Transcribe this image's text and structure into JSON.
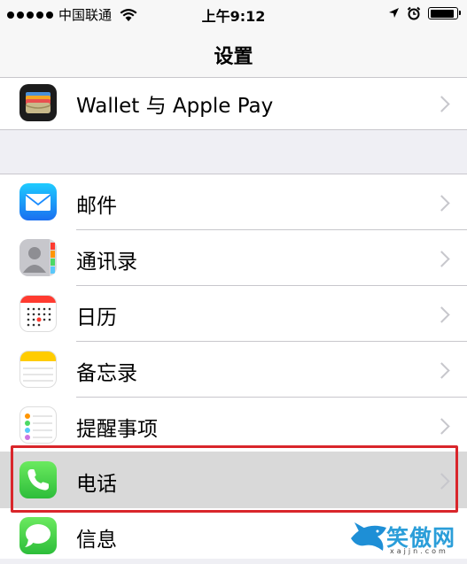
{
  "status_bar": {
    "carrier": "中国联通",
    "time": "上午9:12",
    "battery_level": 0.95
  },
  "nav": {
    "title": "设置"
  },
  "top_group": {
    "items": [
      {
        "label": "Wallet 与 Apple Pay",
        "icon": "wallet-icon"
      }
    ]
  },
  "main_group": {
    "items": [
      {
        "label": "邮件",
        "icon": "mail-icon"
      },
      {
        "label": "通讯录",
        "icon": "contacts-icon"
      },
      {
        "label": "日历",
        "icon": "calendar-icon"
      },
      {
        "label": "备忘录",
        "icon": "notes-icon"
      },
      {
        "label": "提醒事项",
        "icon": "reminders-icon"
      },
      {
        "label": "电话",
        "icon": "phone-icon",
        "highlighted": true
      },
      {
        "label": "信息",
        "icon": "messages-icon"
      }
    ]
  },
  "watermark": {
    "text": "笑傲网",
    "sub": "xajjn.com"
  },
  "colors": {
    "highlight_border": "#d9262b",
    "phone_green": "#4cd964",
    "mail_blue": "#1a8cff"
  }
}
